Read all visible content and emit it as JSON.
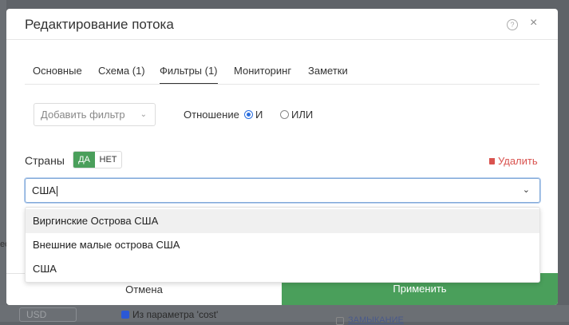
{
  "background": {
    "currency": "USD",
    "param_label": "Из параметра 'cost'",
    "edge_text": "ec",
    "link_text": "ЗАМЫКАНИЕ"
  },
  "modal": {
    "title": "Редактирование потока",
    "help_icon": "?",
    "close_icon": "×",
    "tabs": [
      {
        "label": "Основные"
      },
      {
        "label": "Схема (1)"
      },
      {
        "label": "Фильтры (1)"
      },
      {
        "label": "Мониторинг"
      },
      {
        "label": "Заметки"
      }
    ],
    "active_tab": "Фильтры (1)",
    "add_filter_placeholder": "Добавить фильтр",
    "relation": {
      "label": "Отношение",
      "options": [
        {
          "label": "И",
          "checked": true
        },
        {
          "label": "ИЛИ",
          "checked": false
        }
      ]
    },
    "countries": {
      "label": "Страны",
      "toggle_yes": "ДА",
      "toggle_no": "НЕТ",
      "toggle_selected": "ДА",
      "delete_label": "Удалить",
      "search_value": "США",
      "options": [
        {
          "label": "Виргинские Острова США"
        },
        {
          "label": "Внешние малые острова США"
        },
        {
          "label": "США"
        }
      ]
    },
    "footer": {
      "cancel_label": "Отмена",
      "apply_label": "Применить"
    }
  },
  "colors": {
    "accent_green": "#4a9f5b",
    "delete_red": "#d9534f",
    "radio_blue": "#2b6fe0"
  },
  "icons": [
    "help-icon",
    "close-icon",
    "chevron-down-icon",
    "trash-icon"
  ]
}
